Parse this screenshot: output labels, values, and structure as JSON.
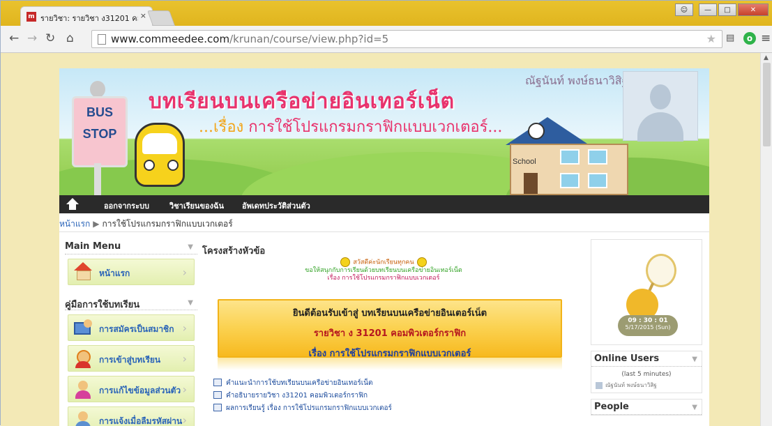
{
  "browser": {
    "tab_title": "รายวิชา: รายวิชา ง31201 คอ",
    "tab_close": "×",
    "url_host": "www.commeedee.com",
    "url_path": "/krunan/course/view.php?id=5"
  },
  "site": {
    "banner_title": "บทเรียนบนเครือข่ายอินเทอร์เน็ต",
    "banner_subtitle_prefix": "...เรื่อง",
    "banner_subtitle": "การใช้โปรแกรมกราฟิกแบบเวกเตอร์...",
    "teacher_name": "ณัฐนันท์ พงษ์ธนาวิสิฐ",
    "bus_text_1": "BUS",
    "bus_text_2": "STOP",
    "school_label": "School"
  },
  "navbar": {
    "items": [
      "ออกจากระบบ",
      "วิชาเรียนของฉัน",
      "อัพเดทประวัติส่วนตัว"
    ]
  },
  "breadcrumb": {
    "home": "หน้าแรก",
    "separator": "▶",
    "current": "การใช้โปรแกรมกราฟิกแบบเวกเตอร์"
  },
  "left": {
    "main_menu_title": "Main Menu",
    "main_menu_items": [
      "หน้าแรก"
    ],
    "guide_title": "คู่มือการใช้บทเรียน",
    "guide_items": [
      "การสมัครเป็นสมาชิก",
      "การเข้าสู่บทเรียน",
      "การแก้ไขข้อมูลส่วนตัว",
      "การแจ้งเมื่อลืมรหัสผ่าน"
    ]
  },
  "center": {
    "section_title": "โครงสร้างหัวข้อ",
    "greet_1": "สวัสดีค่ะนักเรียนทุกคน",
    "greet_2": "ขอให้สนุกกับการเรียนด้วยบทเรียนบนเครือข่ายอินเทอร์เน็ต",
    "greet_3": "เรื่อง การใช้โปรแกรมกราฟิกแบบเวกเตอร์",
    "welcome_1": "ยินดีต้อนรับเข้าสู่ บทเรียนบนเครือข่ายอินเตอร์เน็ต",
    "welcome_2": "รายวิชา ง 31201 คอมพิวเตอร์กราฟิก",
    "welcome_3": "เรื่อง การใช้โปรแกรมกราฟิกแบบเวกเตอร์",
    "resources": [
      "คำแนะนำการใช้บทเรียนบนเครือข่ายอินเทอร์เน็ต",
      "คำอธิบายรายวิชา ง31201 คอมพิวเตอร์กราฟิก",
      "ผลการเรียนรู้ เรื่อง การใช้โปรแกรมกราฟิกแบบเวกเตอร์"
    ]
  },
  "right": {
    "clock_time": "09 : 30 : 01",
    "clock_date": "5/17/2015 (Sun)",
    "online_title": "Online Users",
    "online_sub": "(last 5 minutes)",
    "online_user": "ณัฐนันท์ พงษ์ธนาวิสิฐ",
    "people_title": "People"
  }
}
